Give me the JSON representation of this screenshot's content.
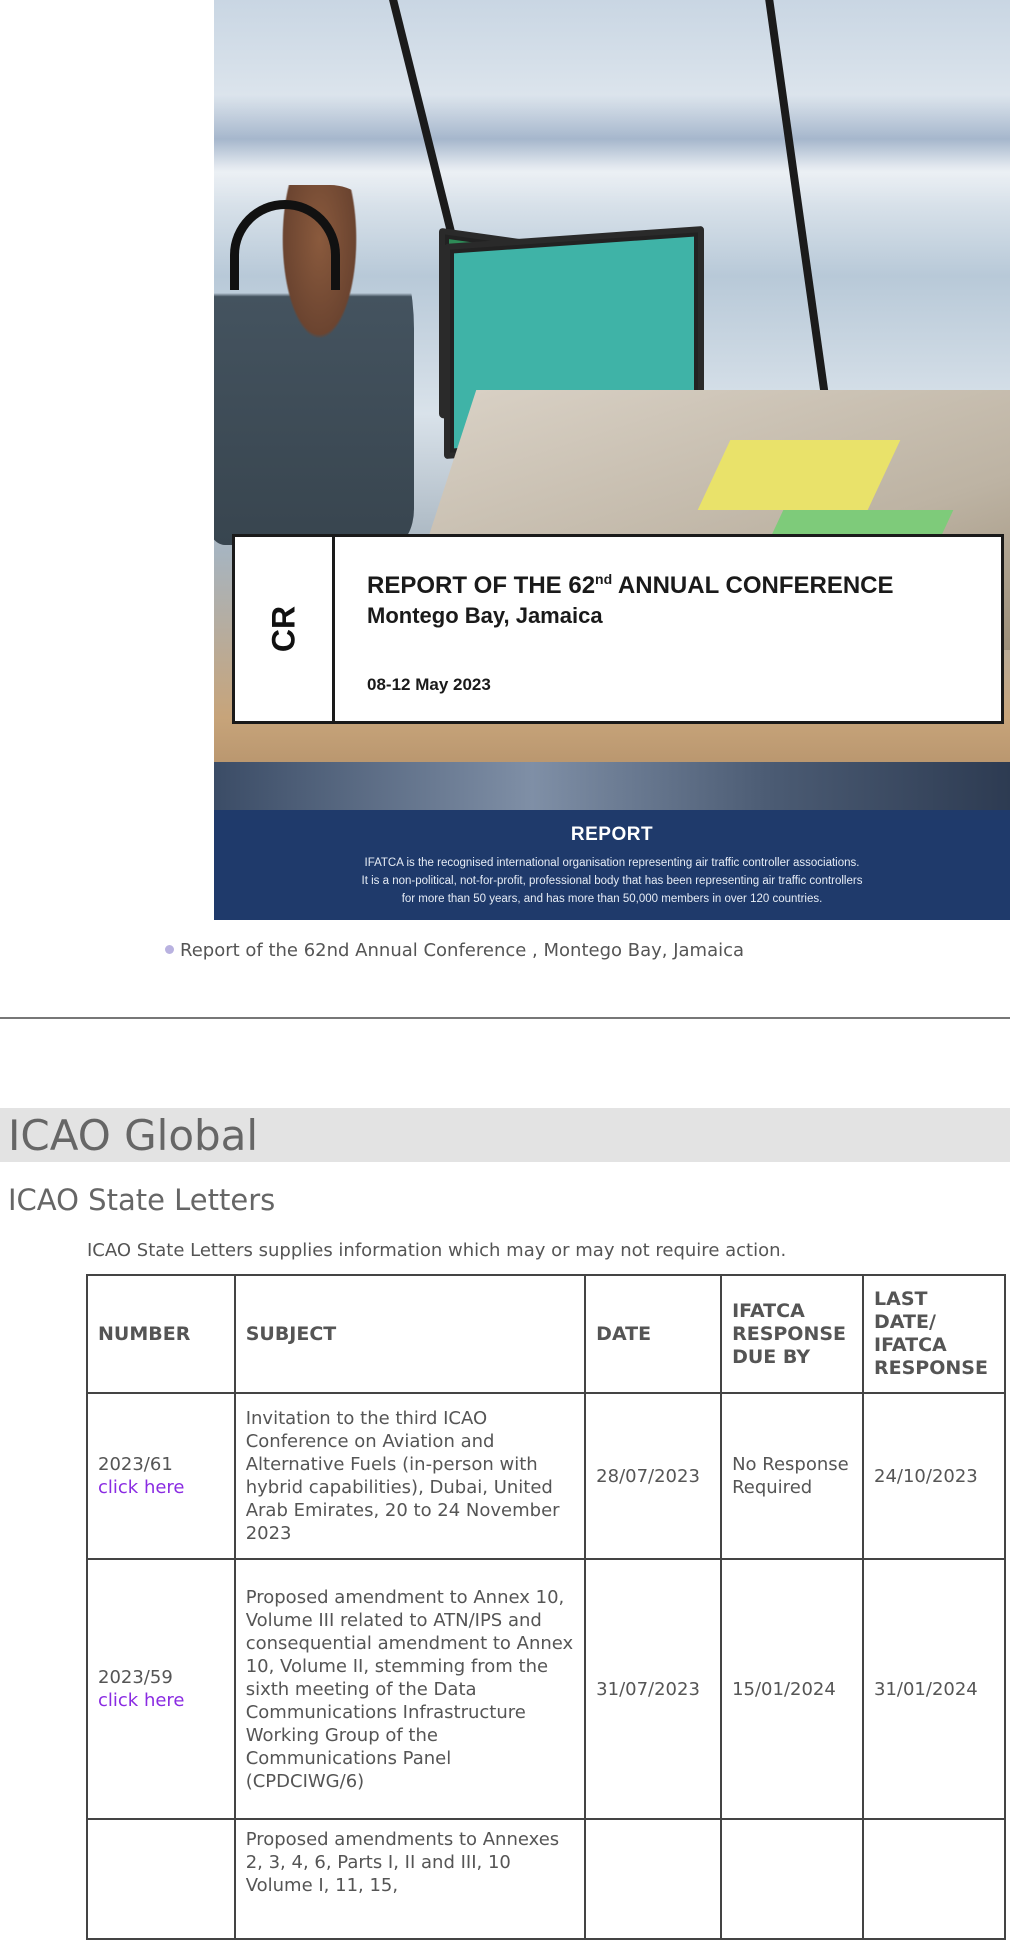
{
  "cover": {
    "side_label": "CR",
    "title_prefix": "REPORT OF THE 62",
    "title_sup": "nd",
    "title_suffix": " ANNUAL CONFERENCE",
    "location": "Montego Bay, Jamaica",
    "dates": "08-12 May 2023",
    "footer_label": "REPORT",
    "footer_text_1": "IFATCA is the recognised international organisation representing air traffic controller associations.",
    "footer_text_2": "It is a non-political, not-for-profit, professional body that has been representing air traffic controllers",
    "footer_text_3": "for more than 50 years, and has more than 50,000 members in over 120 countries."
  },
  "caption": "Report of the 62nd Annual Conference , Montego Bay, Jamaica",
  "section": {
    "title": "ICAO Global",
    "subtitle": "ICAO State Letters",
    "intro": "ICAO State Letters supplies information which may or may not require action."
  },
  "table": {
    "headers": {
      "number": "NUMBER",
      "subject": "SUBJECT",
      "date": "DATE",
      "due": "IFATCA RESPONSE DUE BY",
      "last": "LAST DATE/ IFATCA RESPONSE"
    },
    "rows": [
      {
        "number": "2023/61",
        "link": "click here",
        "subject": "Invitation to the third ICAO Conference on Aviation and Alternative Fuels (in-person with hybrid capabilities), Dubai, United Arab Emirates, 20 to 24 November 2023",
        "date": "28/07/2023",
        "due": "No Response Required",
        "last": "24/10/2023"
      },
      {
        "number": "2023/59",
        "link": "click here",
        "subject": "Proposed amendment to Annex 10, Volume III related to ATN/IPS and consequential amendment to Annex 10, Volume II, stemming from the sixth meeting of the Data Communications Infrastructure Working Group of the Communications Panel (CPDCIWG/6)",
        "date": "31/07/2023",
        "due": "15/01/2024",
        "last": "31/01/2024"
      },
      {
        "number": "",
        "link": "",
        "subject": "Proposed amendments to Annexes 2, 3, 4, 6, Parts I, II and III, 10 Volume I, 11, 15,",
        "date": "",
        "due": "",
        "last": ""
      }
    ]
  }
}
